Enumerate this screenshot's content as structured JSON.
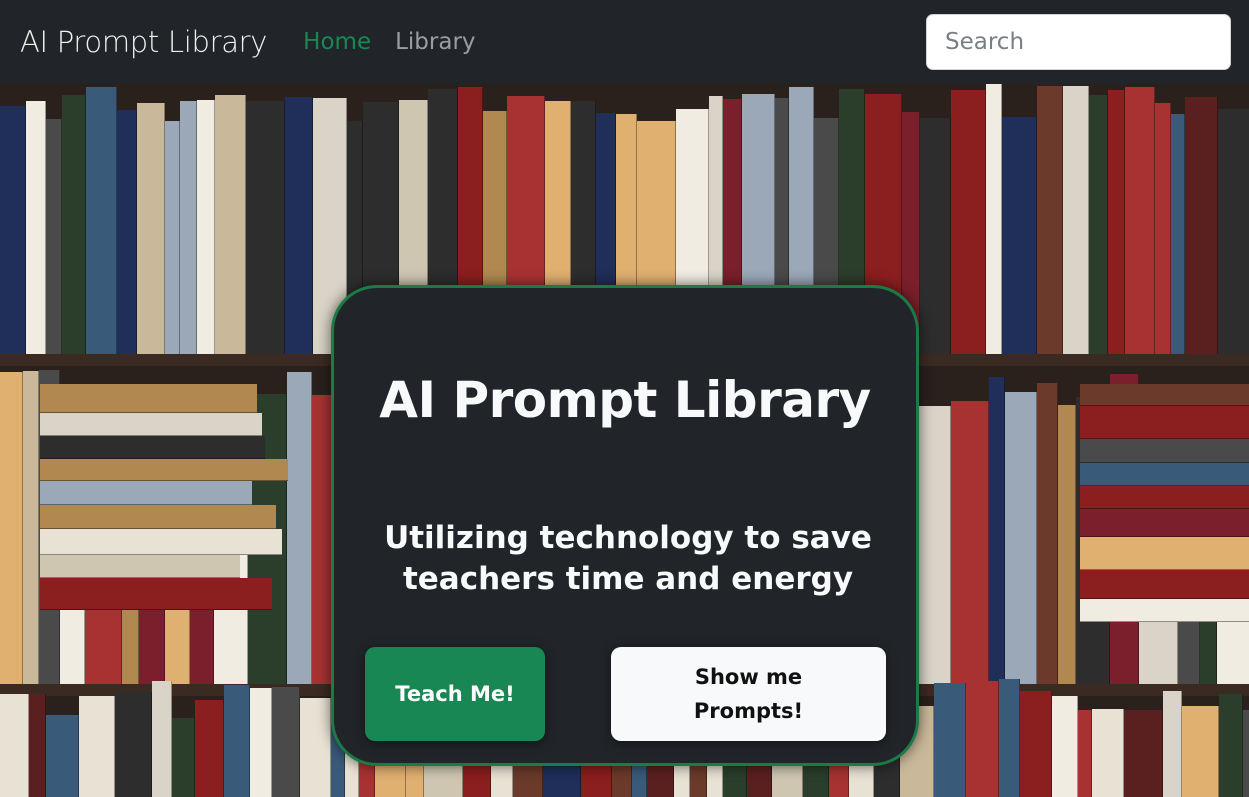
{
  "navbar": {
    "brand": "AI Prompt Library",
    "links": [
      {
        "label": "Home",
        "active": true
      },
      {
        "label": "Library",
        "active": false
      }
    ],
    "search_placeholder": "Search"
  },
  "hero": {
    "background": "bookshelf-photo",
    "card": {
      "title": "AI Prompt Library",
      "subtitle": "Utilizing technology to save teachers time and energy",
      "primary_button": "Teach Me!",
      "secondary_button": "Show me Prompts!"
    }
  },
  "colors": {
    "accent": "#198754",
    "navbar_bg": "#212529",
    "card_border": "#1c7a47"
  }
}
